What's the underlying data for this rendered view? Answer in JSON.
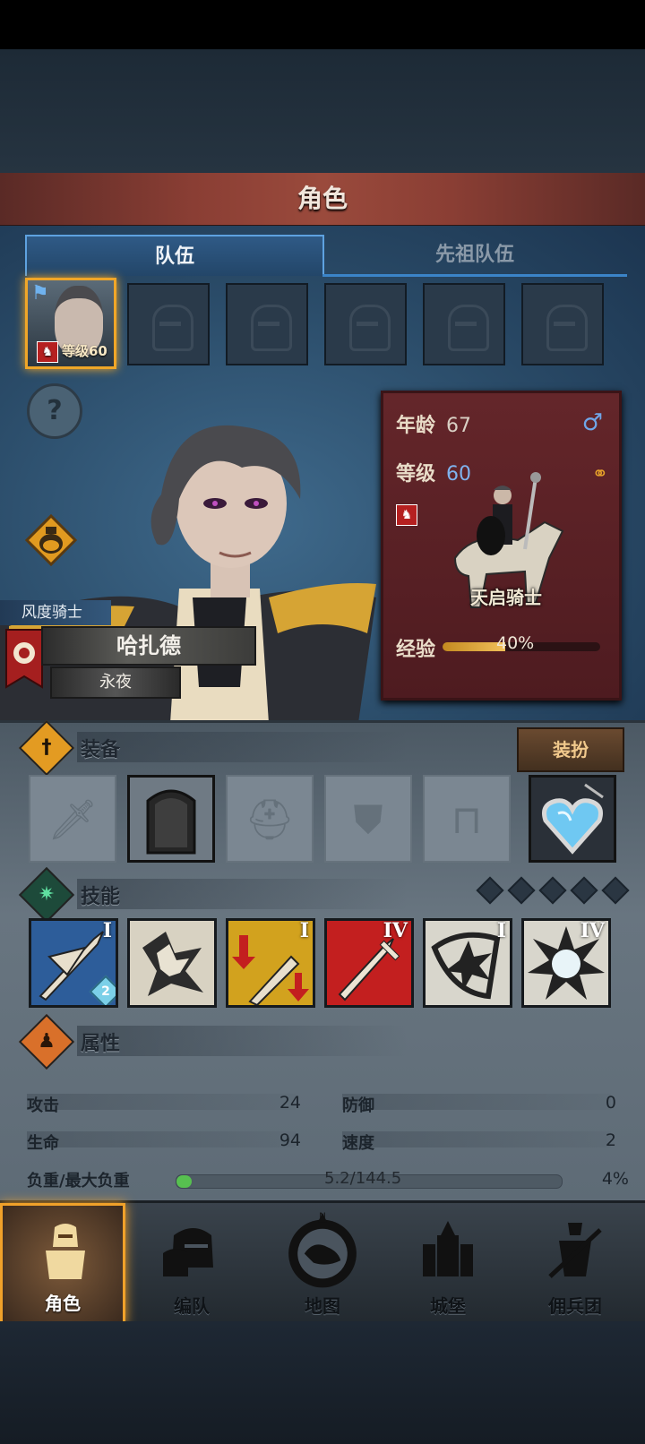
{
  "header": {
    "title": "角色"
  },
  "tabs": [
    {
      "label": "队伍",
      "active": true
    },
    {
      "label": "先祖队伍",
      "active": false
    }
  ],
  "party": {
    "active_member": {
      "level_label": "等级60"
    },
    "empty_slots": 5
  },
  "character": {
    "class_label": "风度骑士",
    "name": "哈扎德",
    "title": "永夜"
  },
  "info_card": {
    "age_label": "年龄",
    "age_value": "67",
    "level_label": "等级",
    "level_value": "60",
    "gender_icon": "male-icon",
    "mount_name": "天启骑士",
    "exp_label": "经验",
    "exp_value": "40%",
    "exp_fraction": 0.4
  },
  "equipment": {
    "label": "装备",
    "dress_button": "装扮",
    "slots": [
      "sword-icon",
      "shield-icon",
      "helmet-icon",
      "armor-icon",
      "boots-icon",
      "amulet-icon"
    ]
  },
  "skills": {
    "label": "技能",
    "items": [
      {
        "icon": "sword-strike-icon",
        "rank": "I",
        "badge": "2",
        "color": "#2d5d9a"
      },
      {
        "icon": "crystal-burst-icon",
        "rank": "",
        "badge": "",
        "color": "#d8d2c2"
      },
      {
        "icon": "broken-sword-icon",
        "rank": "I",
        "badge": "",
        "color": "#d2a21e"
      },
      {
        "icon": "red-sword-icon",
        "rank": "IV",
        "badge": "",
        "color": "#c31f1f"
      },
      {
        "icon": "shield-blast-icon",
        "rank": "I",
        "badge": "",
        "color": "#d8d6cc"
      },
      {
        "icon": "explosion-icon",
        "rank": "IV",
        "badge": "",
        "color": "#d8d6cc"
      }
    ]
  },
  "attributes": {
    "label": "属性",
    "attack_label": "攻击",
    "attack_value": "24",
    "defense_label": "防御",
    "defense_value": "0",
    "life_label": "生命",
    "life_value": "94",
    "speed_label": "速度",
    "speed_value": "2",
    "load_label": "负重/最大负重",
    "load_value": "5.2/144.5",
    "load_pct": "4%"
  },
  "nav": [
    {
      "label": "角色",
      "active": true
    },
    {
      "label": "编队",
      "active": false
    },
    {
      "label": "地图",
      "active": false,
      "compass": "N"
    },
    {
      "label": "城堡",
      "active": false
    },
    {
      "label": "佣兵团",
      "active": false
    }
  ]
}
